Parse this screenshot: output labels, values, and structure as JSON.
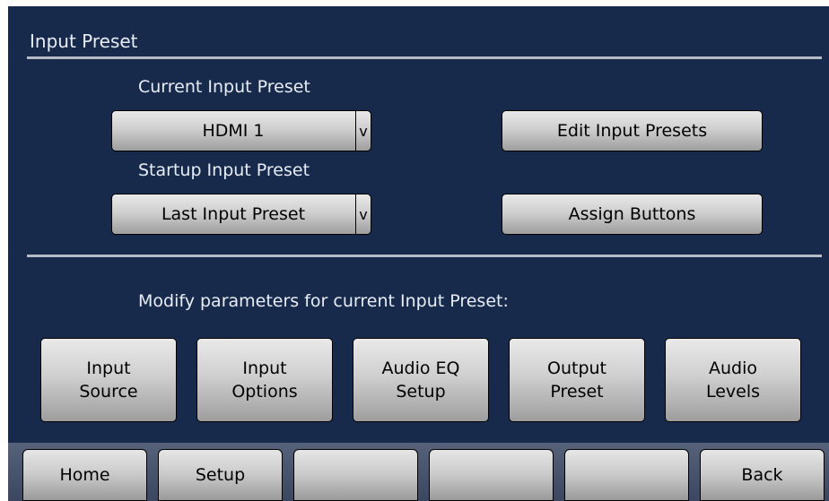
{
  "header": {
    "title": "Input Preset"
  },
  "current_preset": {
    "label": "Current Input Preset",
    "value": "HDMI 1",
    "chevron": "v"
  },
  "startup_preset": {
    "label": "Startup Input Preset",
    "value": "Last Input Preset",
    "chevron": "v"
  },
  "actions": {
    "edit_presets": "Edit Input Presets",
    "assign_buttons": "Assign Buttons"
  },
  "modify": {
    "label": "Modify parameters for current Input Preset:",
    "buttons": [
      "Input\nSource",
      "Input\nOptions",
      "Audio EQ\nSetup",
      "Output\nPreset",
      "Audio\nLevels"
    ]
  },
  "footer": {
    "buttons": [
      "Home",
      "Setup",
      "",
      "",
      "",
      "Back"
    ]
  }
}
